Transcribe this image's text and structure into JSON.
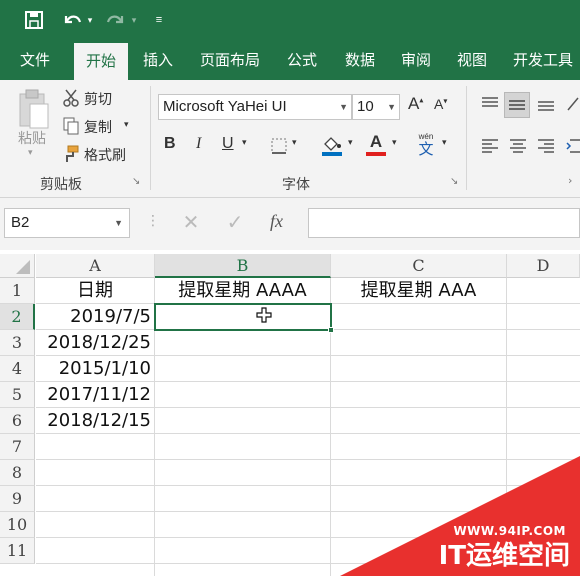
{
  "ribbon_tabs": [
    "文件",
    "开始",
    "插入",
    "页面布局",
    "公式",
    "数据",
    "审阅",
    "视图",
    "开发工具"
  ],
  "active_tab": "开始",
  "clipboard": {
    "paste_label": "粘贴",
    "cut_label": "剪切",
    "copy_label": "复制",
    "format_painter_label": "格式刷",
    "group_label": "剪贴板"
  },
  "font": {
    "font_name": "Microsoft YaHei UI",
    "font_size": "10",
    "bold": "B",
    "italic": "I",
    "underline": "U",
    "font_color_letter": "A",
    "phonetic_top": "wén",
    "phonetic_char": "文",
    "grow_letter": "A",
    "shrink_letter": "A",
    "group_label": "字体"
  },
  "formula_bar": {
    "name_box": "B2",
    "fx": "fx",
    "value": ""
  },
  "sheet": {
    "columns": [
      "A",
      "B",
      "C",
      "D"
    ],
    "rows": [
      "1",
      "2",
      "3",
      "4",
      "5",
      "6",
      "7",
      "8",
      "9",
      "10",
      "11"
    ],
    "selected_cell": "B2",
    "cells": {
      "A1": "日期",
      "B1": "提取星期 AAAA",
      "C1": "提取星期 AAA",
      "A2": "2019/7/5",
      "A3": "2018/12/25",
      "A4": "2015/1/10",
      "A5": "2017/11/12",
      "A6": "2018/12/15"
    }
  },
  "watermark": {
    "url": "WWW.94IP.COM",
    "name": "IT运维空间"
  },
  "colors": {
    "accent": "#217346",
    "watermark": "#e8302e"
  }
}
